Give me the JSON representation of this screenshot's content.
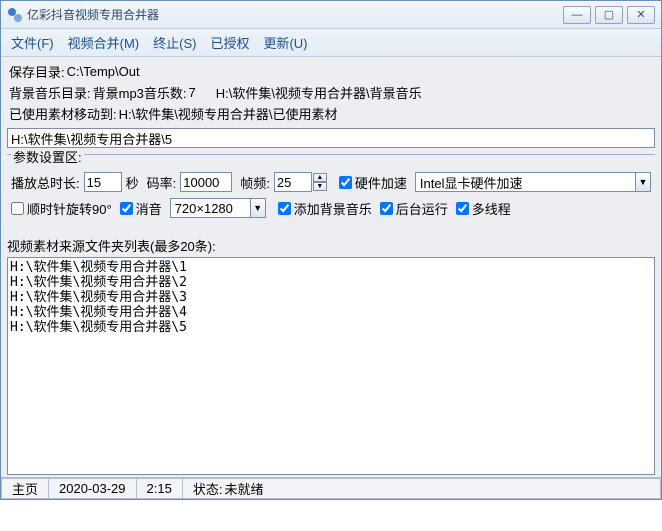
{
  "title": "亿彩抖音视频专用合并器",
  "window_controls": {
    "min": "—",
    "max": "▢",
    "close": "✕"
  },
  "menu": {
    "file": "文件(F)",
    "merge": "视频合并(M)",
    "stop": "终止(S)",
    "licensed": "已授权",
    "update": "更新(U)"
  },
  "info": {
    "save_dir_label": "保存目录:",
    "save_dir_value": "C:\\Temp\\Out",
    "bgm_dir_label": "背景音乐目录:",
    "bgm_count_label": "背景mp3音乐数:",
    "bgm_count_value": "7",
    "bgm_path_value": "H:\\软件集\\视频专用合并器\\背景音乐",
    "used_label": "已使用素材移动到:",
    "used_path_value": "H:\\软件集\\视频专用合并器\\已使用素材",
    "path_input_value": "H:\\软件集\\视频专用合并器\\5"
  },
  "fieldset_legend": "参数设置区:",
  "params": {
    "duration_label": "播放总时长:",
    "duration_value": "15",
    "duration_unit": "秒",
    "bitrate_label": "码率:",
    "bitrate_value": "10000",
    "fps_label": "帧频:",
    "fps_value": "25",
    "hwaccel_label": "硬件加速",
    "hwaccel_checked": true,
    "hwaccel_option": "Intel显卡硬件加速",
    "rotate_label": "顺时针旋转90°",
    "rotate_checked": false,
    "mute_label": "消音",
    "mute_checked": true,
    "resolution_option": "720×1280",
    "addbgm_label": "添加背景音乐",
    "addbgm_checked": true,
    "background_label": "后台运行",
    "background_checked": true,
    "multithread_label": "多线程",
    "multithread_checked": true
  },
  "list_label": "视频素材来源文件夹列表(最多20条):",
  "source_list": [
    "H:\\软件集\\视频专用合并器\\1",
    "H:\\软件集\\视频专用合并器\\2",
    "H:\\软件集\\视频专用合并器\\3",
    "H:\\软件集\\视频专用合并器\\4",
    "H:\\软件集\\视频专用合并器\\5"
  ],
  "status": {
    "home": "主页",
    "date": "2020-03-29",
    "time": "2:15",
    "state_label": "状态:",
    "state_value": "未就绪"
  }
}
